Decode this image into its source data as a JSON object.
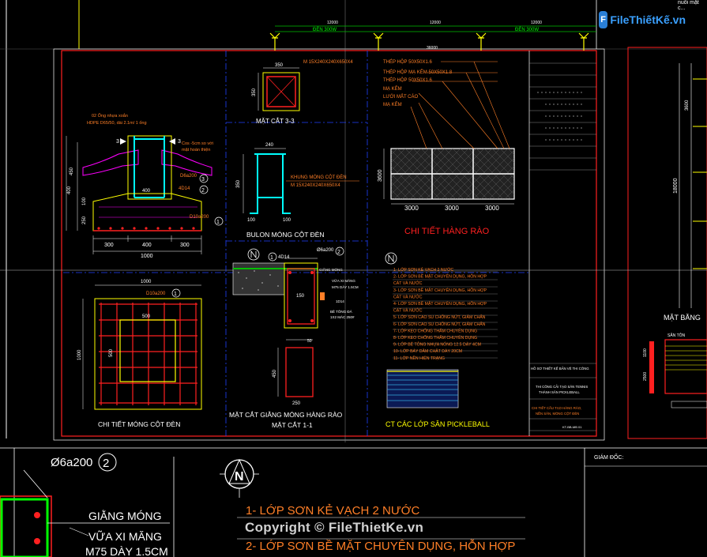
{
  "logo": {
    "badge": "F",
    "text": "FileThiếtKế.vn",
    "corner_note": "nuôi mặt c..."
  },
  "watermark": "Copyright © FileThietKe.vn",
  "top_dims": {
    "d1": "12000",
    "d2": "12000",
    "d3": "12000",
    "den1": "ĐÈN 300W",
    "den2": "ĐÈN 300W",
    "total": "36000"
  },
  "mong_cot_den": {
    "pipe_note_1": "02 Ống nhựa xoắn",
    "pipe_note_2": "HDPE D65/50, dài 2.1m/ 1 ống",
    "ground_note_1": "Cos -5cm so với",
    "ground_note_2": "mặt hoàn thiện",
    "rebar1": "D6a200",
    "rebar2": "4D14",
    "rebar3": "D10a200",
    "dim_300a": "300",
    "dim_400": "400",
    "dim_300b": "300",
    "dim_1000": "1000",
    "dim_left_450": "450",
    "dim_left_400": "400",
    "dim_left_100": "100",
    "dim_left_250": "250",
    "dim_inner_400": "400",
    "num1": "1",
    "num2": "2",
    "num3": "3",
    "sec": "3"
  },
  "mat_cat_33": {
    "top_dim": "350",
    "left_dim": "350",
    "spec": "M 15X240X240X650X4",
    "title": "MẶT CẮT 3-3"
  },
  "bulon": {
    "top_dim": "240",
    "left_dim": "350",
    "bot1": "100",
    "bot2": "100",
    "spec1": "KHUNG MÓNG CỘT ĐÈN",
    "spec2": "M 15X240X240X650X4",
    "title": "BULON MÓNG CỘT ĐÈN"
  },
  "hang_rao": {
    "labels": [
      "THÉP HỘP 50X50X1.6",
      "THÉP HỘP MẠ KẼM 50X50X1.8",
      "THÉP HỘP 50X50X1.6",
      "MẠ KẼM",
      "LƯỚI MẮT CÁO",
      "MẠ KẼM"
    ],
    "dims": [
      "3000",
      "3000",
      "3000"
    ],
    "height": "3600",
    "title": "CHI TIẾT HÀNG RÀO"
  },
  "plan_mong": {
    "top_dim": "1000",
    "rebar": "D10a200",
    "inner_top": "500",
    "inner_left": "500",
    "left_dim": "1000",
    "num": "1",
    "title": "CHI TIẾT MÓNG CỘT ĐÈN"
  },
  "giang_mong": {
    "rebar_top": "4D14",
    "rebar_side": "Ø6a200",
    "n1": "1",
    "n2": "2",
    "notes": [
      "GIẰNG MÓNG",
      "VỮA XI MĂNG",
      "M75 DÀY 1.5CM",
      "1D14",
      "BÊ TÔNG ĐÁ",
      "1X2 MÁC 250#"
    ],
    "dim_top": "200",
    "dim_150": "150",
    "small_top": "50",
    "small_side": "450",
    "small_bot": "250",
    "title1": "MẶT CẮT GIẰNG MÓNG HÀNG RÀO",
    "title2": "MẶT CẮT 1-1"
  },
  "layers": {
    "items": [
      "1- LỚP SƠN KẺ VẠCH 2 NƯỚC",
      "2- LỚP SƠN BỀ MẶT CHUYÊN DỤNG, HỖN HỢP",
      "CÁT VÀ NƯỚC",
      "3- LỚP SƠN BỀ MẶT CHUYÊN DỤNG, HỖN HỢP",
      "CÁT VÀ NƯỚC",
      "4- LỚP SƠN BỀ MẶT CHUYÊN DỤNG, HỖN HỢP",
      "CÁT VÀ NƯỚC",
      "5- LỚP SƠN CAO SU CHỐNG NỨT, GIẢM CHẤN",
      "6- LỚP SƠN CAO SU CHỐNG NỨT, GIẢM CHẤN",
      "7- LỚP KEO CHỐNG THẤM CHUYÊN DỤNG",
      "8- LỚP KEO CHỐNG THẤM CHUYÊN DỤNG",
      "9- LỚP BÊ TÔNG NHỰA NÓNG 12.5 DÀY 4CM",
      "10- LỚP BÁY DĂM CHẶT DÀY 20CM",
      "11- LỚP NỀN HIỆN TRẠNG"
    ],
    "title": "CT CÁC LỚP SÂN PICKLEBALL"
  },
  "title_block": {
    "project": "HỒ SƠ THIẾT KẾ BẢN VẼ THI CÔNG",
    "work1": "THI CÔNG CẢI TẠO SÂN TENNIS",
    "work2": "THÀNH SÂN PICKLEBALL",
    "drawing1": "CHI TIẾT CẤU TẠO HÀNG RÀO,",
    "drawing2": "NỀN SÂN, MÓNG CỘT ĐÈN",
    "code": "KT-BB-MB 01"
  },
  "right_view": {
    "dim_big": "18000",
    "dim_small": "3600",
    "title": "MẶT BẰNG",
    "san_ton": "SÂN TÔN",
    "d1": "1100",
    "d2": "2500"
  },
  "bottom": {
    "rebar": "Ø6a200",
    "num": "2",
    "notes": [
      "GIẰNG MÓNG",
      "VỮA XI MĂNG",
      "M75 DÀY 1.5CM"
    ],
    "layer1": "1- LỚP SƠN KẺ VẠCH 2 NƯỚC",
    "layer2": "2- LỚP SƠN BỀ MẶT CHUYÊN DỤNG, HỖN HỢP",
    "giam_doc": "GIÁM ĐỐC:",
    "north": "N"
  },
  "colors": {
    "bg": "#000000",
    "red": "#ff2020",
    "yellow": "#ffff00",
    "cyan": "#00ffff",
    "white": "#ffffff",
    "orange": "#ff7f27",
    "gray": "#808080",
    "blue": "#2040ff",
    "green": "#00c000",
    "brand": "#3aa0ff"
  }
}
